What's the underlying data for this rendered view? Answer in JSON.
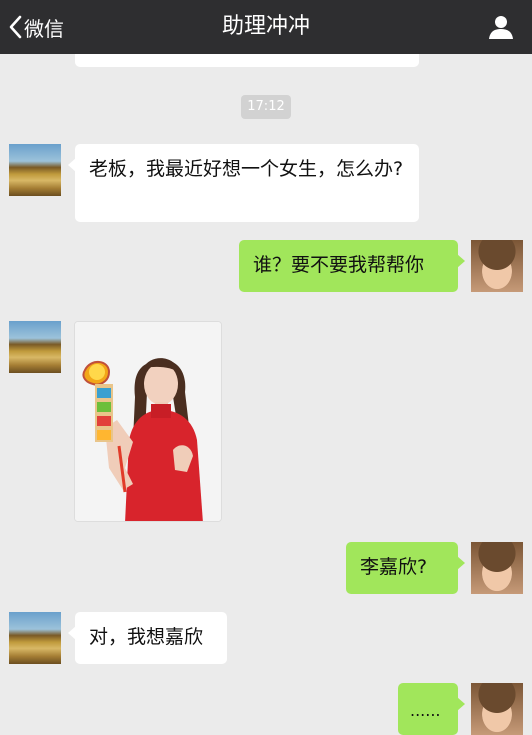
{
  "nav": {
    "back_label": "微信",
    "title": "助理冲冲"
  },
  "timestamp": "17:12",
  "messages": [
    {
      "side": "left",
      "text": "老板，我最近好想一个女生，怎么办?"
    },
    {
      "side": "right",
      "text": "谁？要不要我帮帮你"
    },
    {
      "side": "left",
      "type": "image"
    },
    {
      "side": "right",
      "text": "李嘉欣?"
    },
    {
      "side": "left",
      "text": "对，我想嘉欣"
    },
    {
      "side": "right",
      "text": "......"
    }
  ],
  "colors": {
    "navbar": "#2e2e30",
    "background": "#ebebeb",
    "sent_bubble": "#a1e65b",
    "received_bubble": "#ffffff"
  },
  "icons": {
    "back": "chevron-left-icon",
    "profile": "person-icon"
  }
}
